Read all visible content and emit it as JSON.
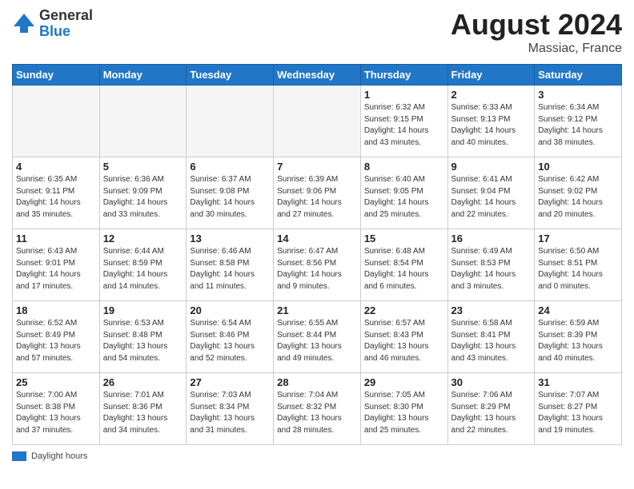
{
  "header": {
    "logo_general": "General",
    "logo_blue": "Blue",
    "month_year": "August 2024",
    "location": "Massiac, France"
  },
  "footer": {
    "legend_label": "Daylight hours"
  },
  "days_of_week": [
    "Sunday",
    "Monday",
    "Tuesday",
    "Wednesday",
    "Thursday",
    "Friday",
    "Saturday"
  ],
  "weeks": [
    {
      "days": [
        {
          "num": "",
          "info": ""
        },
        {
          "num": "",
          "info": ""
        },
        {
          "num": "",
          "info": ""
        },
        {
          "num": "",
          "info": ""
        },
        {
          "num": "1",
          "info": "Sunrise: 6:32 AM\nSunset: 9:15 PM\nDaylight: 14 hours\nand 43 minutes."
        },
        {
          "num": "2",
          "info": "Sunrise: 6:33 AM\nSunset: 9:13 PM\nDaylight: 14 hours\nand 40 minutes."
        },
        {
          "num": "3",
          "info": "Sunrise: 6:34 AM\nSunset: 9:12 PM\nDaylight: 14 hours\nand 38 minutes."
        }
      ]
    },
    {
      "days": [
        {
          "num": "4",
          "info": "Sunrise: 6:35 AM\nSunset: 9:11 PM\nDaylight: 14 hours\nand 35 minutes."
        },
        {
          "num": "5",
          "info": "Sunrise: 6:36 AM\nSunset: 9:09 PM\nDaylight: 14 hours\nand 33 minutes."
        },
        {
          "num": "6",
          "info": "Sunrise: 6:37 AM\nSunset: 9:08 PM\nDaylight: 14 hours\nand 30 minutes."
        },
        {
          "num": "7",
          "info": "Sunrise: 6:39 AM\nSunset: 9:06 PM\nDaylight: 14 hours\nand 27 minutes."
        },
        {
          "num": "8",
          "info": "Sunrise: 6:40 AM\nSunset: 9:05 PM\nDaylight: 14 hours\nand 25 minutes."
        },
        {
          "num": "9",
          "info": "Sunrise: 6:41 AM\nSunset: 9:04 PM\nDaylight: 14 hours\nand 22 minutes."
        },
        {
          "num": "10",
          "info": "Sunrise: 6:42 AM\nSunset: 9:02 PM\nDaylight: 14 hours\nand 20 minutes."
        }
      ]
    },
    {
      "days": [
        {
          "num": "11",
          "info": "Sunrise: 6:43 AM\nSunset: 9:01 PM\nDaylight: 14 hours\nand 17 minutes."
        },
        {
          "num": "12",
          "info": "Sunrise: 6:44 AM\nSunset: 8:59 PM\nDaylight: 14 hours\nand 14 minutes."
        },
        {
          "num": "13",
          "info": "Sunrise: 6:46 AM\nSunset: 8:58 PM\nDaylight: 14 hours\nand 11 minutes."
        },
        {
          "num": "14",
          "info": "Sunrise: 6:47 AM\nSunset: 8:56 PM\nDaylight: 14 hours\nand 9 minutes."
        },
        {
          "num": "15",
          "info": "Sunrise: 6:48 AM\nSunset: 8:54 PM\nDaylight: 14 hours\nand 6 minutes."
        },
        {
          "num": "16",
          "info": "Sunrise: 6:49 AM\nSunset: 8:53 PM\nDaylight: 14 hours\nand 3 minutes."
        },
        {
          "num": "17",
          "info": "Sunrise: 6:50 AM\nSunset: 8:51 PM\nDaylight: 14 hours\nand 0 minutes."
        }
      ]
    },
    {
      "days": [
        {
          "num": "18",
          "info": "Sunrise: 6:52 AM\nSunset: 8:49 PM\nDaylight: 13 hours\nand 57 minutes."
        },
        {
          "num": "19",
          "info": "Sunrise: 6:53 AM\nSunset: 8:48 PM\nDaylight: 13 hours\nand 54 minutes."
        },
        {
          "num": "20",
          "info": "Sunrise: 6:54 AM\nSunset: 8:46 PM\nDaylight: 13 hours\nand 52 minutes."
        },
        {
          "num": "21",
          "info": "Sunrise: 6:55 AM\nSunset: 8:44 PM\nDaylight: 13 hours\nand 49 minutes."
        },
        {
          "num": "22",
          "info": "Sunrise: 6:57 AM\nSunset: 8:43 PM\nDaylight: 13 hours\nand 46 minutes."
        },
        {
          "num": "23",
          "info": "Sunrise: 6:58 AM\nSunset: 8:41 PM\nDaylight: 13 hours\nand 43 minutes."
        },
        {
          "num": "24",
          "info": "Sunrise: 6:59 AM\nSunset: 8:39 PM\nDaylight: 13 hours\nand 40 minutes."
        }
      ]
    },
    {
      "days": [
        {
          "num": "25",
          "info": "Sunrise: 7:00 AM\nSunset: 8:38 PM\nDaylight: 13 hours\nand 37 minutes."
        },
        {
          "num": "26",
          "info": "Sunrise: 7:01 AM\nSunset: 8:36 PM\nDaylight: 13 hours\nand 34 minutes."
        },
        {
          "num": "27",
          "info": "Sunrise: 7:03 AM\nSunset: 8:34 PM\nDaylight: 13 hours\nand 31 minutes."
        },
        {
          "num": "28",
          "info": "Sunrise: 7:04 AM\nSunset: 8:32 PM\nDaylight: 13 hours\nand 28 minutes."
        },
        {
          "num": "29",
          "info": "Sunrise: 7:05 AM\nSunset: 8:30 PM\nDaylight: 13 hours\nand 25 minutes."
        },
        {
          "num": "30",
          "info": "Sunrise: 7:06 AM\nSunset: 8:29 PM\nDaylight: 13 hours\nand 22 minutes."
        },
        {
          "num": "31",
          "info": "Sunrise: 7:07 AM\nSunset: 8:27 PM\nDaylight: 13 hours\nand 19 minutes."
        }
      ]
    }
  ]
}
